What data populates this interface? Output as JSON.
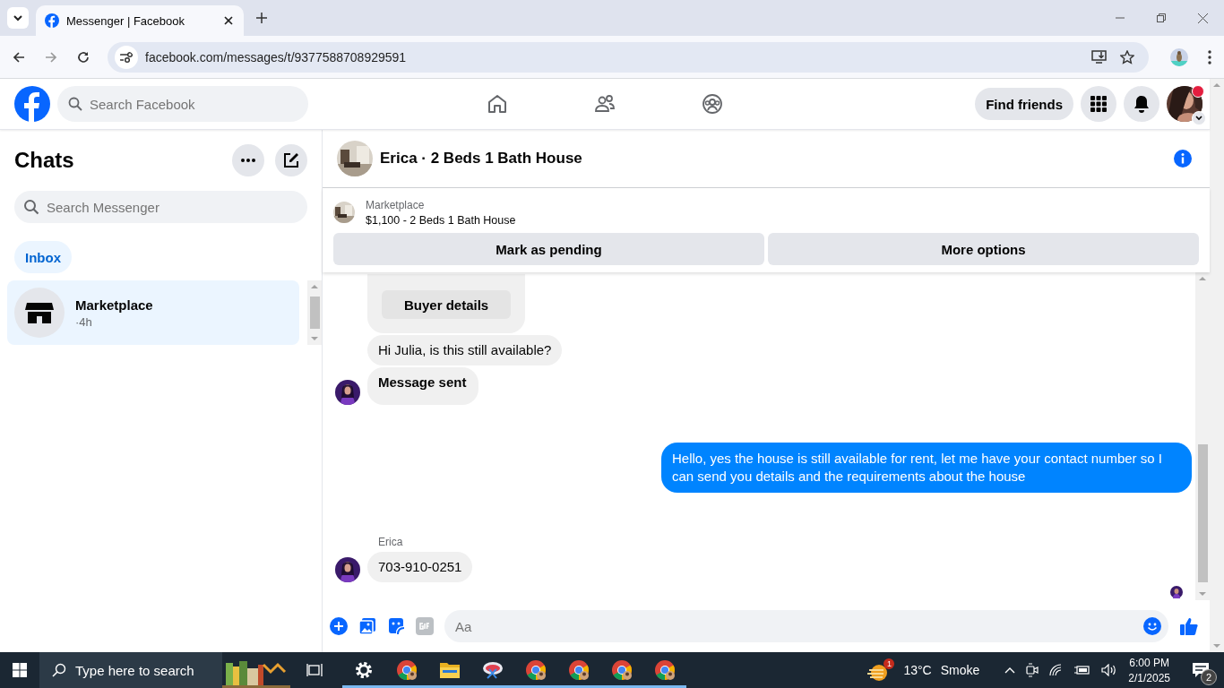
{
  "browser": {
    "tab_title": "Messenger | Facebook",
    "url": "facebook.com/messages/t/9377588708929591"
  },
  "nav": {
    "search_placeholder": "Search Facebook",
    "find_friends": "Find friends",
    "notification_dot": true
  },
  "sidebar": {
    "title": "Chats",
    "search_placeholder": "Search Messenger",
    "filters": [
      {
        "label": "Inbox",
        "selected": true
      }
    ],
    "chats": [
      {
        "name": "Marketplace",
        "time": "·4h",
        "selected": true
      }
    ]
  },
  "chat": {
    "title": "Erica · 2 Beds 1 Bath House",
    "listing": {
      "source": "Marketplace",
      "title": "$1,100 - 2 Beds 1 Bath House"
    },
    "actions": [
      "Mark as pending",
      "More options"
    ],
    "messages": [
      {
        "kind": "card",
        "button": "Buyer details"
      },
      {
        "kind": "incoming",
        "text": "Hi Julia, is this still available?",
        "avatar": false
      },
      {
        "kind": "notice",
        "text": "Message sent",
        "avatar": true
      },
      {
        "kind": "outgoing",
        "text": "Hello, yes the house is still available for rent, let me have your contact number so I can send you details and the requirements about the house"
      },
      {
        "kind": "incoming",
        "sender": "Erica",
        "text": "703-910-0251",
        "avatar": true
      }
    ],
    "seen": true,
    "composer": {
      "placeholder": "Aa"
    }
  },
  "taskbar": {
    "search_placeholder": "Type here to search",
    "weather": {
      "badge": "1",
      "temp": "13°C",
      "condition": "Smoke"
    },
    "time": "6:00 PM",
    "date": "2/1/2025",
    "notifications": "2"
  }
}
